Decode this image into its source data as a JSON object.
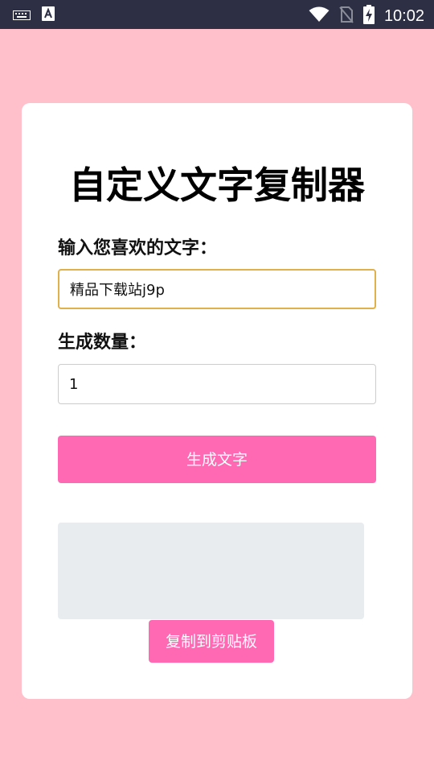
{
  "status_bar": {
    "time": "10:02",
    "icons": [
      "keyboard-icon",
      "text-a-icon",
      "wifi-icon",
      "no-sim-icon",
      "battery-charging-icon"
    ]
  },
  "app": {
    "title": "自定义文字复制器",
    "text_label": "输入您喜欢的文字：",
    "text_value": "精品下载站j9p",
    "count_label": "生成数量：",
    "count_value": "1",
    "generate_button": "生成文字",
    "output_text": "",
    "copy_button": "复制到剪贴板"
  },
  "colors": {
    "background": "#ffc0cb",
    "status_bar": "#2d2f44",
    "accent": "#ff69b4",
    "focus_border": "#e0b04a",
    "output_bg": "#e8ecef"
  }
}
